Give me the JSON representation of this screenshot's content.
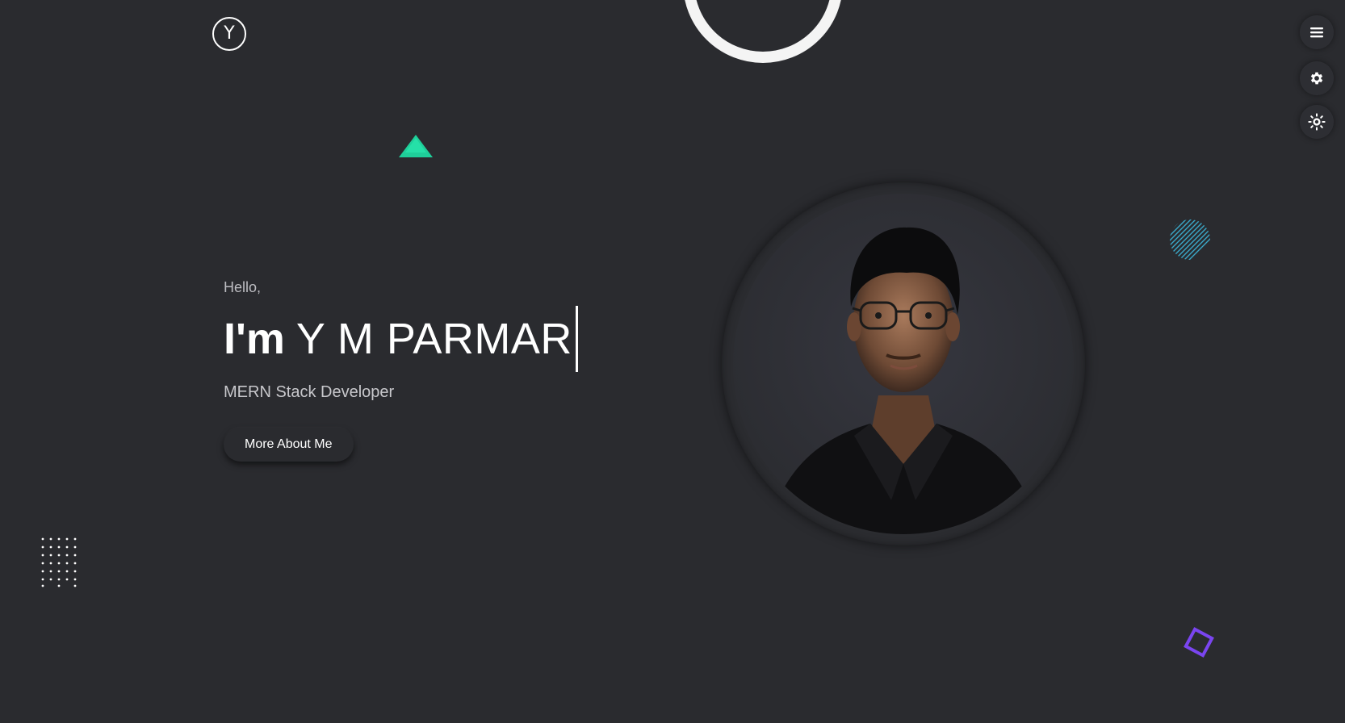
{
  "logo": {
    "letter": "Y"
  },
  "hero": {
    "greeting": "Hello,",
    "im": "I'm",
    "name": "Y M PARMAR",
    "role": "MERN Stack Developer",
    "button_label": "More About Me"
  },
  "side_controls": [
    {
      "icon": "menu-icon"
    },
    {
      "icon": "gear-icon"
    },
    {
      "icon": "sun-icon"
    }
  ],
  "decorations": {
    "triangle_color": "#1fcf9a",
    "stripes_color": "#3aa8c8",
    "diamond_color": "#7a45f0",
    "ring_color": "#f4f4f4"
  },
  "colors": {
    "background": "#2a2b2f",
    "text": "#ffffff",
    "muted": "#bdbdc2"
  }
}
